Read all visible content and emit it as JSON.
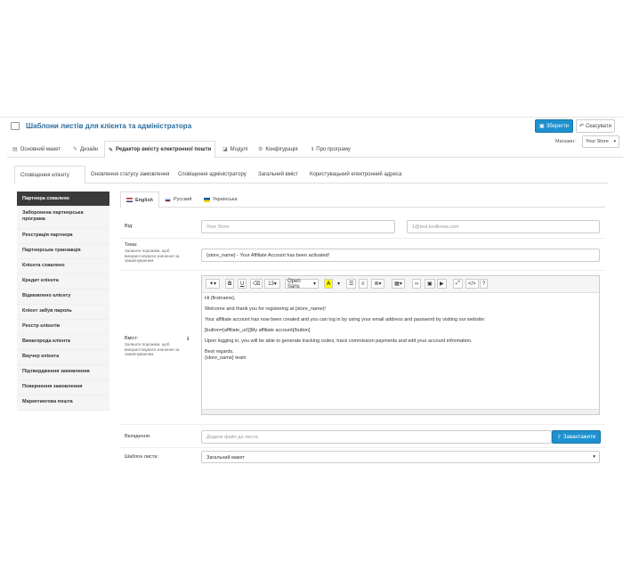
{
  "header": {
    "title": "Шаблони листів для клієнта та адміністратора",
    "save_label": "Зберегти",
    "cancel_label": "Скасувати",
    "store_label": "Магазин:",
    "store_value": "Your Store"
  },
  "main_tabs": [
    {
      "label": "Основний макет"
    },
    {
      "label": "Дизайн"
    },
    {
      "label": "Редактор вмісту електронної пошти"
    },
    {
      "label": "Модулі"
    },
    {
      "label": "Конфігурація"
    },
    {
      "label": "Про програму"
    }
  ],
  "sub_tabs": [
    {
      "label": "Сповіщення клієнту"
    },
    {
      "label": "Оновлення статусу замовлення"
    },
    {
      "label": "Сповіщення адміністратору"
    },
    {
      "label": "Загальний вміст"
    },
    {
      "label": "Користувацький електронний адреса"
    }
  ],
  "sidebar": {
    "items": [
      {
        "label": "Партнера схвалено"
      },
      {
        "label": "Заборонена партнерська програма"
      },
      {
        "label": "Реєстрація партнера"
      },
      {
        "label": "Партнерська транзакція"
      },
      {
        "label": "Клієнта схвалено"
      },
      {
        "label": "Кредит клієнта"
      },
      {
        "label": "Відмовлено клієнту"
      },
      {
        "label": "Клієнт забув пароль"
      },
      {
        "label": "Реєстр клієнтів"
      },
      {
        "label": "Винагорода клієнта"
      },
      {
        "label": "Ваучер клієнта"
      },
      {
        "label": "Підтвердження замовлення"
      },
      {
        "label": "Повернення замовлення"
      },
      {
        "label": "Маркетингова пошта"
      }
    ]
  },
  "lang_tabs": [
    {
      "label": "English"
    },
    {
      "label": "Русский"
    },
    {
      "label": "Українська"
    }
  ],
  "form": {
    "from_label": "Від:",
    "from_name_placeholder": "Your Store",
    "from_email_placeholder": "1@test.kodkowa.com",
    "subject_label": "Тема:",
    "subject_hint": "Залиште порожнім, щоб використовувати значення за замовчуванням",
    "subject_value": "{store_name} - Your Affiliate Account has been activated!",
    "content_label": "Вміст:",
    "content_hint": "Залиште порожнім, щоб використовувати значення за замовчуванням",
    "attachment_label": "Вкладення:",
    "attachment_placeholder": "Додати файл до листа",
    "upload_label": "Завантажити",
    "template_label": "Шаблон листа:",
    "template_value": "Загальний макет"
  },
  "editor": {
    "font_size": "13",
    "font_name": "Open Sans",
    "lines": [
      "Hi {firstname},",
      "Welcome and thank you for registering at {store_name}!",
      "Your affiliate account has now been created and you can log in by using your email address and password by visiting our website:",
      "[button={affiliate_url}]My affiliate account[/button]",
      "Upon logging in, you will be able to generate tracking codes, track commission payments and edit your account information.",
      "Best regards,",
      "{store_name} team"
    ]
  },
  "colors": {
    "primary": "#1e91cf",
    "title": "#2a6d9e",
    "sidebar_active": "#3a3a3a"
  }
}
